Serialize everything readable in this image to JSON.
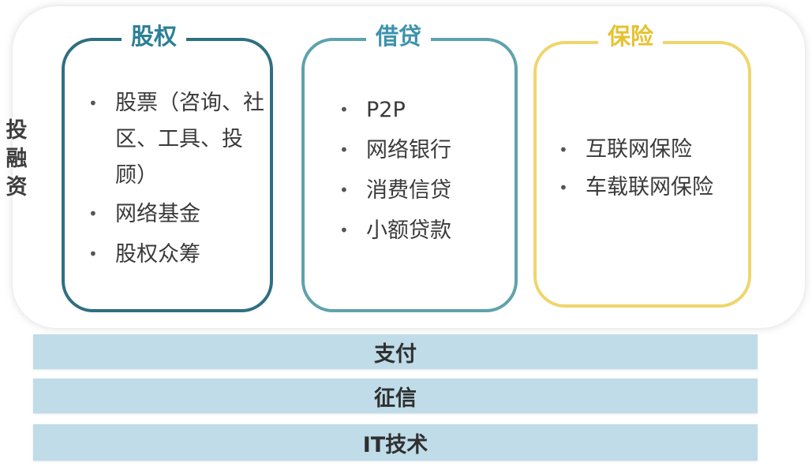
{
  "side_label": [
    "投",
    "融",
    "资"
  ],
  "cards": {
    "equity": {
      "title": "股权",
      "items": [
        "股票（咨询、社区、工具、投顾）",
        "网络基金",
        "股权众筹"
      ]
    },
    "lending": {
      "title": "借贷",
      "items": [
        "P2P",
        "网络银行",
        "消费信贷",
        "小额贷款"
      ]
    },
    "insurance": {
      "title": "保险",
      "items": [
        "互联网保险",
        "车载联网保险"
      ]
    }
  },
  "bars": {
    "payment": "支付",
    "credit": "征信",
    "it": "IT技术"
  },
  "bullet": "•",
  "colors": {
    "equity_border": "#2f6f80",
    "equity_title": "#2c7f96",
    "lending_border": "#5fa2ad",
    "lending_title": "#3d93ad",
    "insurance_border": "#efd56c",
    "insurance_title": "#e6c22f",
    "bar_fill": "#bfdce8"
  }
}
